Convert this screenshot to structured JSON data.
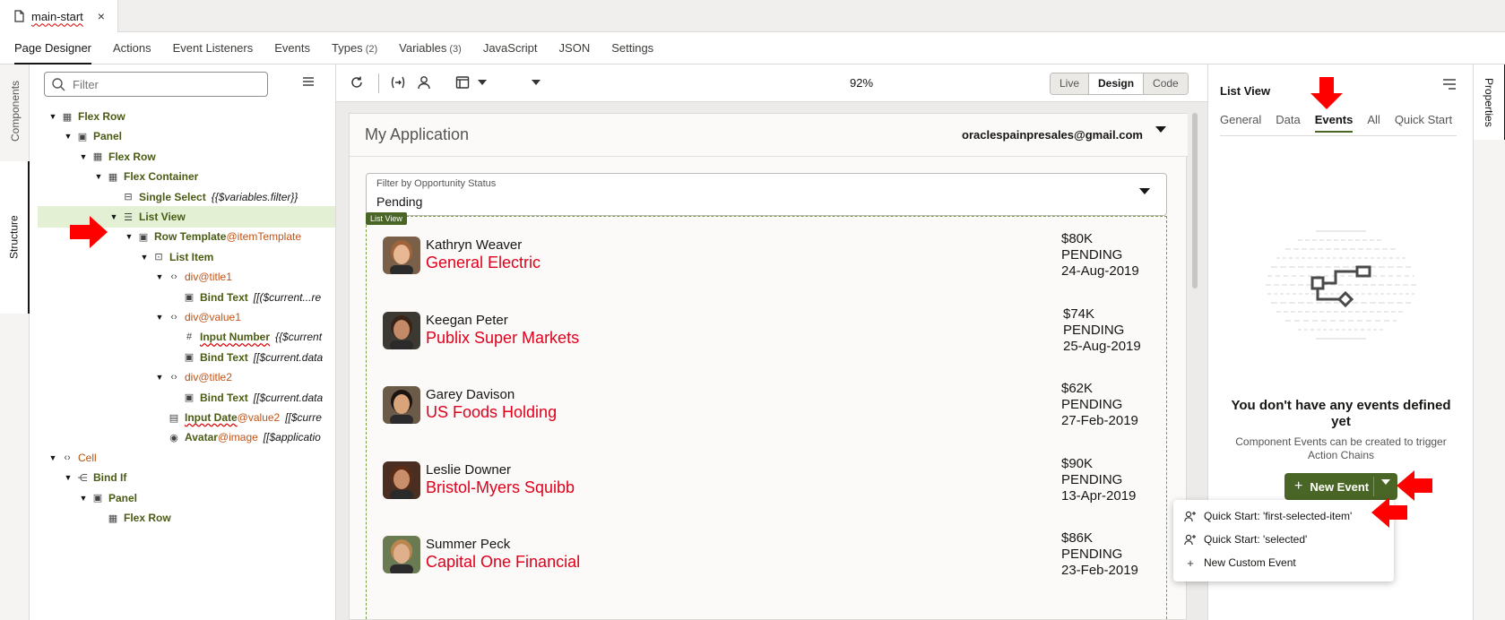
{
  "file_tab": {
    "name": "main-start",
    "close": "×"
  },
  "nav_tabs": [
    {
      "label": "Page Designer",
      "count": "",
      "active": true
    },
    {
      "label": "Actions",
      "count": ""
    },
    {
      "label": "Event Listeners",
      "count": ""
    },
    {
      "label": "Events",
      "count": ""
    },
    {
      "label": "Types",
      "count": "(2)"
    },
    {
      "label": "Variables",
      "count": "(3)"
    },
    {
      "label": "JavaScript",
      "count": ""
    },
    {
      "label": "JSON",
      "count": ""
    },
    {
      "label": "Settings",
      "count": ""
    }
  ],
  "left_rail": {
    "components": "Components",
    "structure": "Structure"
  },
  "structure": {
    "filter_placeholder": "Filter",
    "nodes": [
      {
        "label": "Flex Row",
        "at": "",
        "expr": "",
        "icon": "flex-row-icon"
      },
      {
        "label": "Panel",
        "at": "",
        "expr": "",
        "icon": "panel-icon"
      },
      {
        "label": "Flex Row",
        "at": "",
        "expr": "",
        "icon": "flex-row-icon"
      },
      {
        "label": "Flex Container",
        "at": "",
        "expr": "",
        "icon": "flex-container-icon"
      },
      {
        "label": "Single Select",
        "at": "",
        "expr": "{{$variables.filter}}",
        "icon": "single-select-icon"
      },
      {
        "label": "List View",
        "at": "",
        "expr": "",
        "icon": "list-view-icon"
      },
      {
        "label": "Row Template",
        "at": "@itemTemplate",
        "expr": "",
        "icon": "template-icon"
      },
      {
        "label": "List Item",
        "at": "",
        "expr": "",
        "icon": "list-item-icon"
      },
      {
        "label": "div",
        "at": "@title1",
        "expr": "",
        "icon": "code-icon"
      },
      {
        "label": "Bind Text",
        "at": "",
        "expr": "[[($current...re",
        "icon": "bind-text-icon"
      },
      {
        "label": "div",
        "at": "@value1",
        "expr": "",
        "icon": "code-icon"
      },
      {
        "label": "Input Number",
        "at": "",
        "expr": "{{$current",
        "icon": "hash-icon"
      },
      {
        "label": "Bind Text",
        "at": "",
        "expr": "[[$current.data",
        "icon": "bind-text-icon"
      },
      {
        "label": "div",
        "at": "@title2",
        "expr": "",
        "icon": "code-icon"
      },
      {
        "label": "Bind Text",
        "at": "",
        "expr": "[[$current.data",
        "icon": "bind-text-icon"
      },
      {
        "label": "Input Date",
        "at": "@value2",
        "expr": "[[$curre",
        "icon": "calendar-icon"
      },
      {
        "label": "Avatar",
        "at": "@image",
        "expr": "[[$applicatio",
        "icon": "avatar-icon"
      },
      {
        "label": "Cell",
        "at": "",
        "expr": "",
        "icon": "code-icon"
      },
      {
        "label": "Bind If",
        "at": "",
        "expr": "",
        "icon": "bind-if-icon"
      },
      {
        "label": "Panel",
        "at": "",
        "expr": "",
        "icon": "panel-icon"
      },
      {
        "label": "Flex Row",
        "at": "",
        "expr": "",
        "icon": "flex-row-icon"
      }
    ]
  },
  "toolbar": {
    "zoom": "92%",
    "modes": [
      "Live",
      "Design",
      "Code"
    ],
    "active_mode": "Design"
  },
  "app": {
    "title": "My Application",
    "user_email": "oraclespainpresales@gmail.com",
    "filter_label": "Filter by Opportunity Status",
    "filter_value": "Pending",
    "list_badge": "List View",
    "items": [
      {
        "name": "Kathryn Weaver",
        "company": "General Electric",
        "amount": "$80K",
        "status": "PENDING",
        "date": "24-Aug-2019"
      },
      {
        "name": "Keegan Peter",
        "company": "Publix Super Markets",
        "amount": "$74K",
        "status": "PENDING",
        "date": "25-Aug-2019"
      },
      {
        "name": "Garey Davison",
        "company": "US Foods Holding",
        "amount": "$62K",
        "status": "PENDING",
        "date": "27-Feb-2019"
      },
      {
        "name": "Leslie Downer",
        "company": "Bristol-Myers Squibb",
        "amount": "$90K",
        "status": "PENDING",
        "date": "13-Apr-2019"
      },
      {
        "name": "Summer Peck",
        "company": "Capital One Financial",
        "amount": "$86K",
        "status": "PENDING",
        "date": "23-Feb-2019"
      }
    ]
  },
  "properties": {
    "title": "List View",
    "tabs": [
      "General",
      "Data",
      "Events",
      "All",
      "Quick Start"
    ],
    "active_tab": "Events",
    "empty_heading": "You don't have any events defined yet",
    "empty_sub": "Component Events can be created to trigger Action Chains",
    "new_event_label": "New Event",
    "rail_label": "Properties"
  },
  "menu": {
    "items": [
      {
        "label": "Quick Start: 'first-selected-item'",
        "icon": "person-add-icon"
      },
      {
        "label": "Quick Start: 'selected'",
        "icon": "person-add-icon"
      },
      {
        "label": "New Custom Event",
        "icon": "plus-icon"
      }
    ]
  },
  "colors": {
    "accent": "#4a6626",
    "company_red": "#e0001b",
    "arrow_red": "#ff0000",
    "selected_row": "#e4f0d4"
  }
}
